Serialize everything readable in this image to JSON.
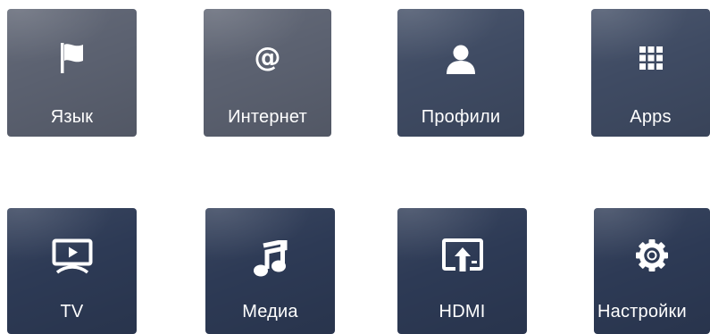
{
  "tiles": [
    {
      "label": "Язык",
      "icon": "flag-icon"
    },
    {
      "label": "Интернет",
      "icon": "at-sign-icon",
      "glyph": "@"
    },
    {
      "label": "Профили",
      "icon": "user-icon"
    },
    {
      "label": "Apps",
      "icon": "app-grid-icon"
    },
    {
      "label": "TV",
      "icon": "tv-play-icon"
    },
    {
      "label": "Медиа",
      "icon": "music-note-icon"
    },
    {
      "label": "HDMI",
      "icon": "hdmi-input-icon"
    },
    {
      "label": "Настройки",
      "icon": "gear-icon"
    }
  ]
}
